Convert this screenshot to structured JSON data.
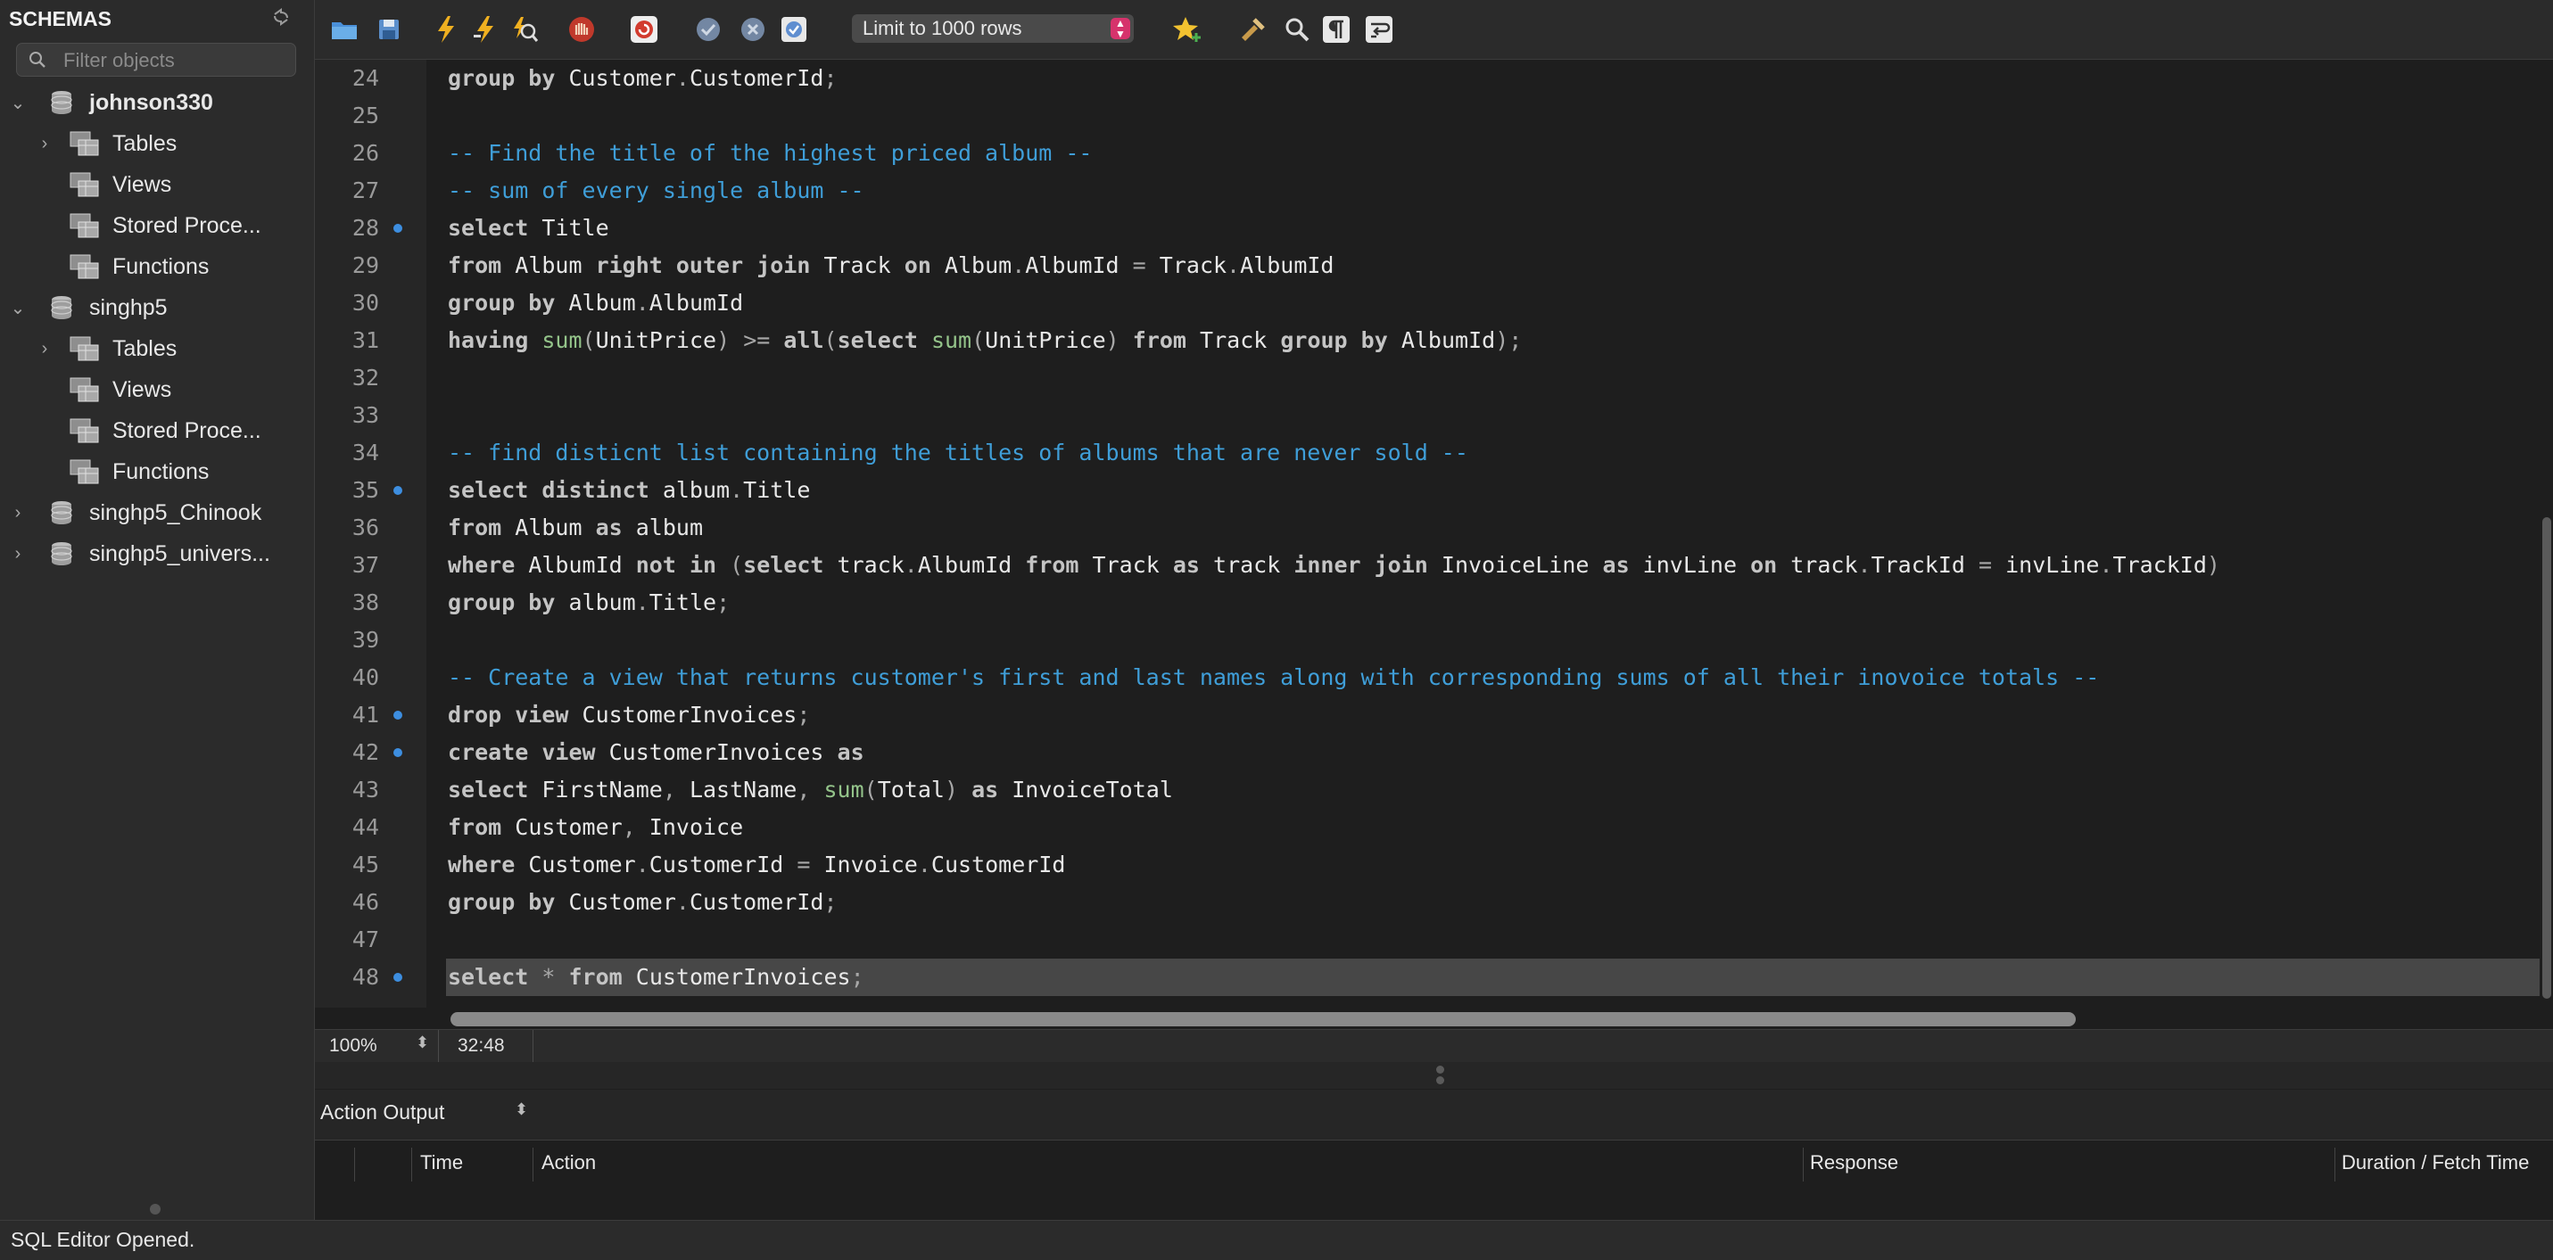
{
  "sidebar": {
    "title": "SCHEMAS",
    "filter_placeholder": "Filter objects",
    "tree": [
      {
        "label": "johnson330",
        "bold": true
      },
      {
        "label": "Tables"
      },
      {
        "label": "Views"
      },
      {
        "label": "Stored Proce..."
      },
      {
        "label": "Functions"
      },
      {
        "label": "singhp5"
      },
      {
        "label": "Tables"
      },
      {
        "label": "Views"
      },
      {
        "label": "Stored Proce..."
      },
      {
        "label": "Functions"
      },
      {
        "label": "singhp5_Chinook"
      },
      {
        "label": "singhp5_univers..."
      }
    ]
  },
  "toolbar": {
    "icons": [
      "open-folder-icon",
      "save-icon",
      "execute-icon",
      "execute-current-icon",
      "explain-icon",
      "stop-icon",
      "toggle-error-icon",
      "commit-icon",
      "rollback-icon",
      "autocommit-icon",
      "bookmark-icon",
      "beautify-icon",
      "find-icon",
      "invisible-chars-icon",
      "wrap-icon"
    ],
    "limit_label": "Limit to 1000 rows"
  },
  "editor": {
    "lines": [
      {
        "n": "24",
        "code": [
          [
            "k",
            "group by"
          ],
          [
            "t",
            " Customer"
          ],
          [
            "p",
            "."
          ],
          [
            "t",
            "CustomerId"
          ],
          [
            "p",
            ";"
          ]
        ]
      },
      {
        "n": "25",
        "code": []
      },
      {
        "n": "26",
        "code": [
          [
            "c",
            "-- Find the title of the highest priced album --"
          ]
        ]
      },
      {
        "n": "27",
        "code": [
          [
            "c",
            "-- sum of every single album --"
          ]
        ]
      },
      {
        "n": "28",
        "marker": true,
        "code": [
          [
            "k",
            "select"
          ],
          [
            "t",
            " Title"
          ]
        ]
      },
      {
        "n": "29",
        "code": [
          [
            "k",
            "from"
          ],
          [
            "t",
            " Album "
          ],
          [
            "k",
            "right outer join"
          ],
          [
            "t",
            " Track "
          ],
          [
            "k",
            "on"
          ],
          [
            "t",
            " Album"
          ],
          [
            "p",
            "."
          ],
          [
            "t",
            "AlbumId "
          ],
          [
            "p",
            "="
          ],
          [
            "t",
            " Track"
          ],
          [
            "p",
            "."
          ],
          [
            "t",
            "AlbumId"
          ]
        ]
      },
      {
        "n": "30",
        "code": [
          [
            "k",
            "group by"
          ],
          [
            "t",
            " Album"
          ],
          [
            "p",
            "."
          ],
          [
            "t",
            "AlbumId"
          ]
        ]
      },
      {
        "n": "31",
        "code": [
          [
            "k",
            "having"
          ],
          [
            "t",
            " "
          ],
          [
            "f",
            "sum"
          ],
          [
            "p",
            "("
          ],
          [
            "t",
            "UnitPrice"
          ],
          [
            "p",
            ")"
          ],
          [
            "t",
            " "
          ],
          [
            "p",
            ">="
          ],
          [
            "t",
            " "
          ],
          [
            "k",
            "all"
          ],
          [
            "p",
            "("
          ],
          [
            "k",
            "select"
          ],
          [
            "t",
            " "
          ],
          [
            "f",
            "sum"
          ],
          [
            "p",
            "("
          ],
          [
            "t",
            "UnitPrice"
          ],
          [
            "p",
            ")"
          ],
          [
            "t",
            " "
          ],
          [
            "k",
            "from"
          ],
          [
            "t",
            " Track "
          ],
          [
            "k",
            "group by"
          ],
          [
            "t",
            " AlbumId"
          ],
          [
            "p",
            ");"
          ]
        ]
      },
      {
        "n": "32",
        "code": []
      },
      {
        "n": "33",
        "code": []
      },
      {
        "n": "34",
        "code": [
          [
            "c",
            "-- find disticnt list containing the titles of albums that are never sold --"
          ]
        ]
      },
      {
        "n": "35",
        "marker": true,
        "code": [
          [
            "k",
            "select distinct"
          ],
          [
            "t",
            " album"
          ],
          [
            "p",
            "."
          ],
          [
            "t",
            "Title"
          ]
        ]
      },
      {
        "n": "36",
        "code": [
          [
            "k",
            "from"
          ],
          [
            "t",
            " Album "
          ],
          [
            "k",
            "as"
          ],
          [
            "t",
            " album"
          ]
        ]
      },
      {
        "n": "37",
        "code": [
          [
            "k",
            "where"
          ],
          [
            "t",
            " AlbumId "
          ],
          [
            "k",
            "not in"
          ],
          [
            "t",
            " "
          ],
          [
            "p",
            "("
          ],
          [
            "k",
            "select"
          ],
          [
            "t",
            " track"
          ],
          [
            "p",
            "."
          ],
          [
            "t",
            "AlbumId "
          ],
          [
            "k",
            "from"
          ],
          [
            "t",
            " Track "
          ],
          [
            "k",
            "as"
          ],
          [
            "t",
            " track "
          ],
          [
            "k",
            "inner join"
          ],
          [
            "t",
            " InvoiceLine "
          ],
          [
            "k",
            "as"
          ],
          [
            "t",
            " invLine "
          ],
          [
            "k",
            "on"
          ],
          [
            "t",
            " track"
          ],
          [
            "p",
            "."
          ],
          [
            "t",
            "TrackId "
          ],
          [
            "p",
            "="
          ],
          [
            "t",
            " invLine"
          ],
          [
            "p",
            "."
          ],
          [
            "t",
            "TrackId"
          ],
          [
            "p",
            ")"
          ]
        ]
      },
      {
        "n": "38",
        "code": [
          [
            "k",
            "group by"
          ],
          [
            "t",
            " album"
          ],
          [
            "p",
            "."
          ],
          [
            "t",
            "Title"
          ],
          [
            "p",
            ";"
          ]
        ]
      },
      {
        "n": "39",
        "code": []
      },
      {
        "n": "40",
        "code": [
          [
            "c",
            "-- Create a view that returns customer's first and last names along with corresponding sums of all their inovoice totals --"
          ]
        ]
      },
      {
        "n": "41",
        "marker": true,
        "code": [
          [
            "k",
            "drop view"
          ],
          [
            "t",
            " CustomerInvoices"
          ],
          [
            "p",
            ";"
          ]
        ]
      },
      {
        "n": "42",
        "marker": true,
        "code": [
          [
            "k",
            "create view"
          ],
          [
            "t",
            " CustomerInvoices "
          ],
          [
            "k",
            "as"
          ]
        ]
      },
      {
        "n": "43",
        "code": [
          [
            "k",
            "select"
          ],
          [
            "t",
            " FirstName"
          ],
          [
            "p",
            ","
          ],
          [
            "t",
            " LastName"
          ],
          [
            "p",
            ","
          ],
          [
            "t",
            " "
          ],
          [
            "f",
            "sum"
          ],
          [
            "p",
            "("
          ],
          [
            "t",
            "Total"
          ],
          [
            "p",
            ")"
          ],
          [
            "t",
            " "
          ],
          [
            "k",
            "as"
          ],
          [
            "t",
            " InvoiceTotal"
          ]
        ]
      },
      {
        "n": "44",
        "code": [
          [
            "k",
            "from"
          ],
          [
            "t",
            " Customer"
          ],
          [
            "p",
            ","
          ],
          [
            "t",
            " Invoice"
          ]
        ]
      },
      {
        "n": "45",
        "code": [
          [
            "k",
            "where"
          ],
          [
            "t",
            " Customer"
          ],
          [
            "p",
            "."
          ],
          [
            "t",
            "CustomerId "
          ],
          [
            "p",
            "="
          ],
          [
            "t",
            " Invoice"
          ],
          [
            "p",
            "."
          ],
          [
            "t",
            "CustomerId"
          ]
        ]
      },
      {
        "n": "46",
        "code": [
          [
            "k",
            "group by"
          ],
          [
            "t",
            " Customer"
          ],
          [
            "p",
            "."
          ],
          [
            "t",
            "CustomerId"
          ],
          [
            "p",
            ";"
          ]
        ]
      },
      {
        "n": "47",
        "code": []
      },
      {
        "n": "48",
        "marker": true,
        "current": true,
        "code": [
          [
            "k",
            "select"
          ],
          [
            "t",
            " "
          ],
          [
            "p",
            "*"
          ],
          [
            "t",
            " "
          ],
          [
            "k",
            "from"
          ],
          [
            "t",
            " CustomerInvoices"
          ],
          [
            "p",
            ";"
          ]
        ]
      }
    ]
  },
  "editor_status": {
    "zoom": "100%",
    "cursor": "32:48"
  },
  "output": {
    "selector": "Action Output",
    "columns": [
      "Time",
      "Action",
      "Response",
      "Duration / Fetch Time"
    ]
  },
  "status": {
    "message": "SQL Editor Opened."
  },
  "colors": {
    "marker": "#3d8ee0",
    "comment": "#3f9ed8",
    "function": "#94c48a",
    "limit_stepper": "#d6336c"
  }
}
